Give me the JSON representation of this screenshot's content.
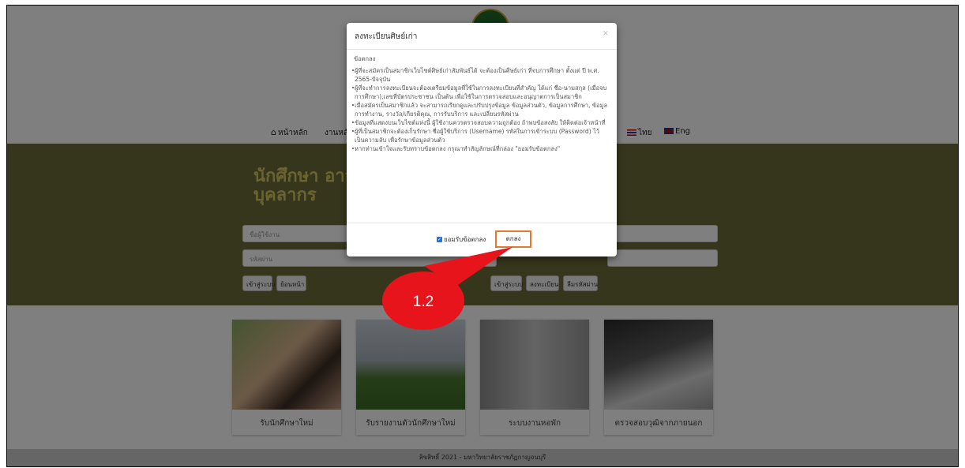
{
  "nav": {
    "home": "หน้าหลัก",
    "work": "งานหลั",
    "thai": "ไทย",
    "eng": "Eng"
  },
  "hero": {
    "title_line1": "นักศึกษา อาจา",
    "title_line2": "บุคลากร",
    "username_placeholder": "ชื่อผู้ใช้งาน",
    "password_placeholder": "รหัสผ่าน",
    "login_label": "เข้าสู่ระบบ",
    "back_label": "ย้อนหน้า",
    "login2_label": "เข้าสู่ระบบ",
    "register_label": "ลงทะเบียน",
    "forgot_label": "ลืมรหัสผ่าน"
  },
  "cards": [
    {
      "label": "รับนักศึกษาใหม่"
    },
    {
      "label": "รับรายงานตัวนักศึกษาใหม่"
    },
    {
      "label": "ระบบงานหอพัก"
    },
    {
      "label": "ตรวจสอบวุฒิจากภายนอก"
    }
  ],
  "footer": {
    "copyright": "ลิขสิทธิ์ 2021 - มหาวิทยาลัยราชภัฏกาญจนบุรี"
  },
  "modal": {
    "title": "ลงทะเบียนศิษย์เก่า",
    "close": "×",
    "subtitle": "ข้อตกลง",
    "items": [
      "ผู้ที่จะสมัครเป็นสมาชิกเว็บไซต์ศิษย์เก่าสัมพันธ์ได้ จะต้องเป็นศิษย์เก่า ที่จบการศึกษา ตั้งแต่ ปี พ.ศ. 2565-ปัจจุบัน",
      "ผู้ที่จะทำการลงทะเบียนจะต้องเตรียมข้อมูลที่ใช้ในการลงทะเบียนที่สำคัญ ได้แก่ ชื่อ-นามสกุล (เมื่อจบการศึกษา),เลขที่บัตรประชาชน เป็นต้น เพื่อใช้ในการตรวจสอบและอนุญาตการเป็นสมาชิก",
      "เมื่อสมัครเป็นสมาชิกแล้ว จะสามารถเรียกดูและปรับปรุงข้อมูล ข้อมูลส่วนตัว, ข้อมูลการศึกษา, ข้อมูลการทำงาน, รางวัล/เกียรติคุณ, การรับบริการ และเปลี่ยนรหัสผ่าน",
      "ข้อมูลที่แสดงบนเว็บไซต์แห่งนี้ ผู้ใช้งานควรตรวจสอบความถูกต้อง ถ้าพบข้อสงสัย ให้ติดต่อเจ้าหน้าที่",
      "ผู้ที่เป็นสมาชิกจะต้องเก็บรักษา ชื่อผู้ใช้บริการ (Username) รหัสในการเข้าระบบ (Password) ไว้เป็นความลับ เพื่อรักษาข้อมูลส่วนตัว",
      "หากท่านเข้าใจและรับทราบข้อตกลง กรุณาทำสัญลักษณ์ที่กล่อง \"ยอมรับข้อตกลง\""
    ],
    "agree_label": "ยอมรับข้อตกลง",
    "ok_label": "ตกลง"
  },
  "callout": {
    "label": "1.2",
    "color": "#e8141c"
  },
  "colors": {
    "hero_bg": "#6d6d38",
    "hero_title": "#d7c860",
    "highlight": "#e8782c"
  }
}
